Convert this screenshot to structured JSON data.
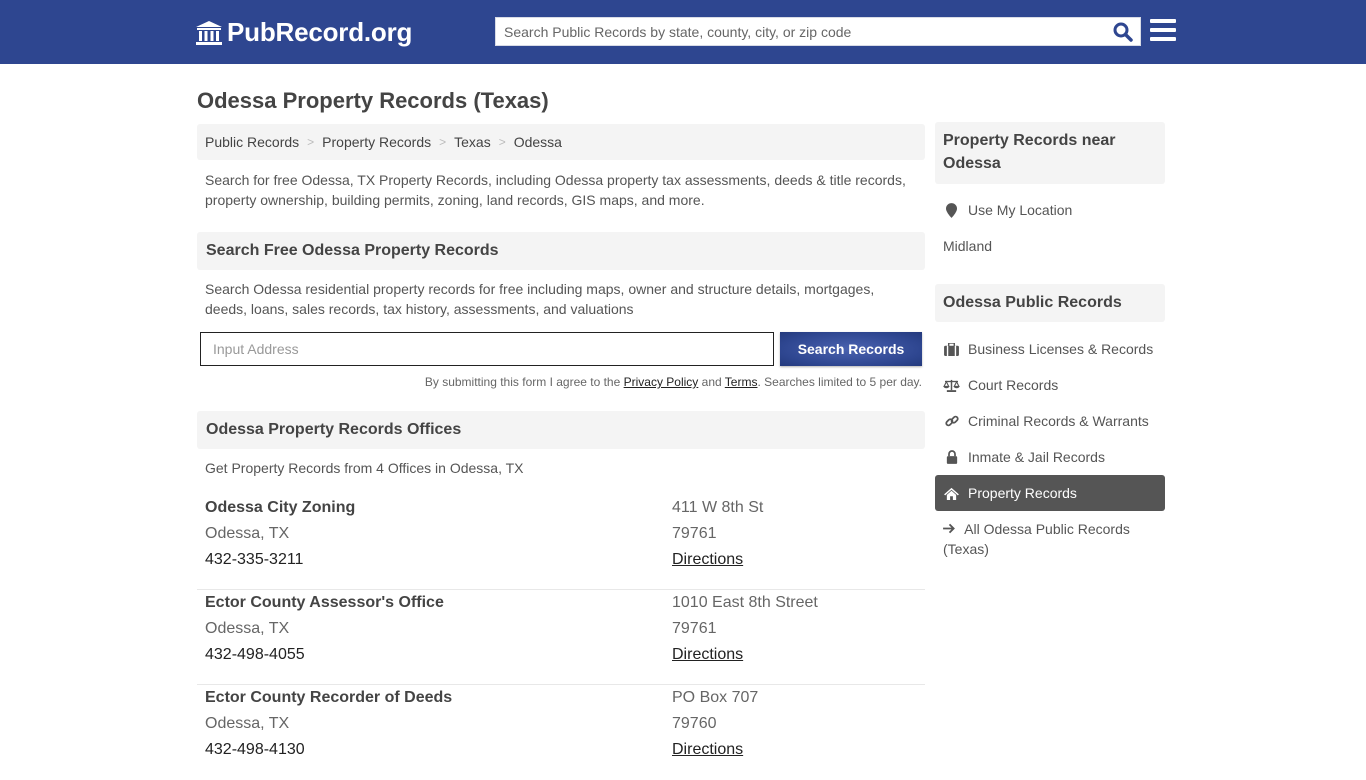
{
  "header": {
    "logo_text": "PubRecord.org",
    "search_placeholder": "Search Public Records by state, county, city, or zip code",
    "brand_color": "#2e4690"
  },
  "page_title": "Odessa Property Records (Texas)",
  "breadcrumb": [
    "Public Records",
    "Property Records",
    "Texas",
    "Odessa"
  ],
  "breadcrumb_separator": ">",
  "intro": "Search for free Odessa, TX Property Records, including Odessa property tax assessments, deeds & title records, property ownership, building permits, zoning, land records, GIS maps, and more.",
  "search_section": {
    "heading": "Search Free Odessa Property Records",
    "description": "Search Odessa residential property records for free including maps, owner and structure details, mortgages, deeds, loans, sales records, tax history, assessments, and valuations",
    "input_placeholder": "Input Address",
    "button_label": "Search Records",
    "disclaimer_prefix": "By submitting this form I agree to the ",
    "privacy_label": "Privacy Policy",
    "and_text": " and ",
    "terms_label": "Terms",
    "disclaimer_suffix": ". Searches limited to 5 per day."
  },
  "offices_section": {
    "heading": "Odessa Property Records Offices",
    "subtitle": "Get Property Records from 4 Offices in Odessa, TX",
    "offices": [
      {
        "name": "Odessa City Zoning",
        "city": "Odessa, TX",
        "phone": "432-335-3211",
        "address": "411 W 8th St",
        "zip": "79761",
        "directions": "Directions"
      },
      {
        "name": "Ector County Assessor's Office",
        "city": "Odessa, TX",
        "phone": "432-498-4055",
        "address": "1010 East 8th Street",
        "zip": "79761",
        "directions": "Directions"
      },
      {
        "name": "Ector County Recorder of Deeds",
        "city": "Odessa, TX",
        "phone": "432-498-4130",
        "address": "PO Box 707",
        "zip": "79760",
        "directions": "Directions"
      }
    ]
  },
  "sidebar": {
    "near_heading": "Property Records near Odessa",
    "use_location": "Use My Location",
    "nearby": [
      "Midland"
    ],
    "public_heading": "Odessa Public Records",
    "items": [
      {
        "label": "Business Licenses & Records",
        "icon": "briefcase-icon",
        "active": false
      },
      {
        "label": "Court Records",
        "icon": "scale-icon",
        "active": false
      },
      {
        "label": "Criminal Records & Warrants",
        "icon": "link-icon",
        "active": false
      },
      {
        "label": "Inmate & Jail Records",
        "icon": "lock-icon",
        "active": false
      },
      {
        "label": "Property Records",
        "icon": "home-icon",
        "active": true
      }
    ],
    "all_records": "All Odessa Public Records (Texas)"
  }
}
